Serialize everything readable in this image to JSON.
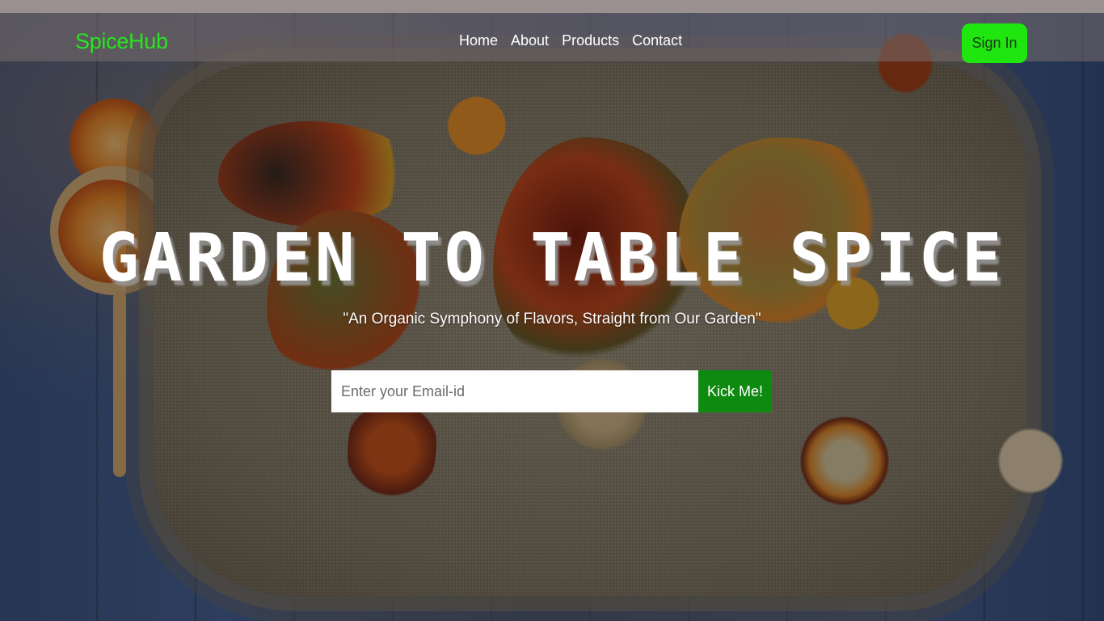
{
  "navbar": {
    "brand": "SpiceHub",
    "links": [
      "Home",
      "About",
      "Products",
      "Contact"
    ],
    "signin_label": "Sign In"
  },
  "hero": {
    "title": "GARDEN TO TABLE SPICE",
    "subtitle": "\"An Organic Symphony of Flavors, Straight from Our Garden\"",
    "email_placeholder": "Enter your Email-id",
    "email_value": "",
    "submit_label": "Kick Me!"
  },
  "colors": {
    "brand_green": "#27e61f",
    "signin_bg": "#1fe60f",
    "submit_bg": "#0e8a10"
  }
}
